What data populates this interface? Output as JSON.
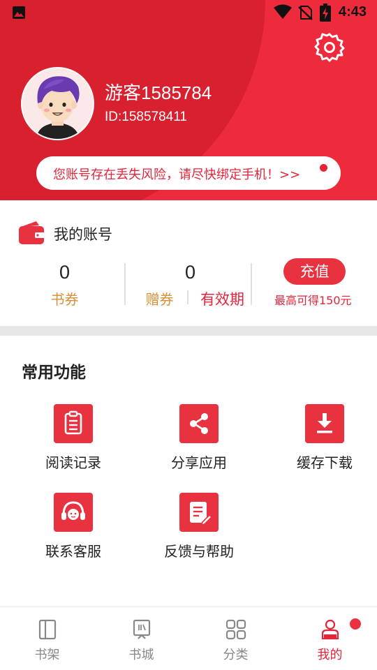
{
  "status_bar": {
    "time": "4:43",
    "icons": [
      "gallery-icon",
      "wifi-icon",
      "no-signal-icon",
      "battery-charging-icon"
    ]
  },
  "header": {
    "username": "游客1585784",
    "user_id": "ID:158578411",
    "warning": "您账号存在丢失风险，请尽快绑定手机！>>",
    "settings_icon": "gear-icon",
    "colors": {
      "primary": "#ee2a3d",
      "arc": "#d8202f"
    }
  },
  "account": {
    "title": "我的账号",
    "book_coupons": {
      "value": "0",
      "label": "书券"
    },
    "gift_coupons": {
      "value": "0",
      "label": "赠券",
      "validity_label": "有效期"
    },
    "recharge": {
      "label": "充值",
      "note": "最高可得150元"
    }
  },
  "functions": {
    "title": "常用功能",
    "items": [
      {
        "label": "阅读记录",
        "icon": "clipboard-icon"
      },
      {
        "label": "分享应用",
        "icon": "share-icon"
      },
      {
        "label": "缓存下载",
        "icon": "download-icon"
      },
      {
        "label": "联系客服",
        "icon": "headset-icon"
      },
      {
        "label": "反馈与帮助",
        "icon": "feedback-icon"
      }
    ]
  },
  "nav": {
    "items": [
      {
        "label": "书架",
        "icon": "bookshelf-icon"
      },
      {
        "label": "书城",
        "icon": "bookstore-icon"
      },
      {
        "label": "分类",
        "icon": "category-icon"
      },
      {
        "label": "我的",
        "icon": "profile-icon",
        "active": true
      }
    ]
  }
}
